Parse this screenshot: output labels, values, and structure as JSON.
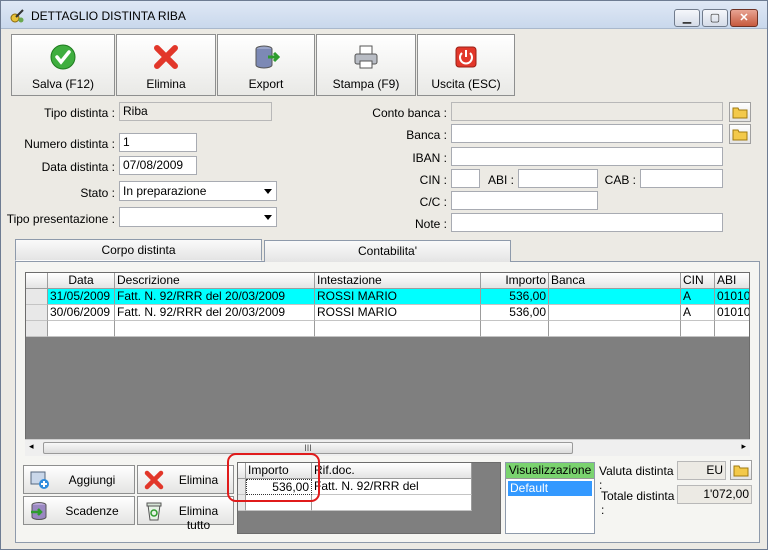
{
  "window": {
    "title": "DETTAGLIO DISTINTA RIBA",
    "btn_min": "▁",
    "btn_max": "▢",
    "btn_close": "✕"
  },
  "toolbar": [
    {
      "label": "Salva (F12)",
      "icon": "check-icon"
    },
    {
      "label": "Elimina",
      "icon": "delete-x-icon"
    },
    {
      "label": "Export",
      "icon": "export-database-icon"
    },
    {
      "label": "Stampa (F9)",
      "icon": "printer-icon"
    },
    {
      "label": "Uscita (ESC)",
      "icon": "power-exit-icon"
    }
  ],
  "form": {
    "tipo_distinta_label": "Tipo distinta :",
    "tipo_distinta_value": "Riba",
    "numero_label": "Numero distinta :",
    "numero_value": "1",
    "data_label": "Data distinta :",
    "data_value": "07/08/2009",
    "stato_label": "Stato :",
    "stato_value": "In preparazione",
    "tipo_pres_label": "Tipo presentazione :",
    "tipo_pres_value": "",
    "conto_banca_label": "Conto banca :",
    "conto_banca_value": "",
    "banca_label": "Banca :",
    "banca_value": "",
    "iban_label": "IBAN :",
    "iban_value": "",
    "cin_label": "CIN :",
    "cin_value": "",
    "abi_label": "ABI :",
    "abi_value": "",
    "cab_label": "CAB :",
    "cab_value": "",
    "cc_label": "C/C :",
    "cc_value": "",
    "note_label": "Note :",
    "note_value": ""
  },
  "tabs": [
    {
      "label": "Corpo distinta",
      "active": true
    },
    {
      "label": "Contabilita'",
      "active": false
    }
  ],
  "grid": {
    "columns": [
      "Data",
      "Descrizione",
      "Intestazione",
      "Importo",
      "Banca",
      "CIN",
      "ABI"
    ],
    "rows": [
      {
        "data": "31/05/2009",
        "descrizione": "Fatt. N. 92/RRR del 20/03/2009",
        "intestazione": "ROSSI MARIO",
        "importo": "536,00",
        "banca": "",
        "cin": "A",
        "abi": "01010",
        "selected": true
      },
      {
        "data": "30/06/2009",
        "descrizione": "Fatt. N. 92/RRR del 20/03/2009",
        "intestazione": "ROSSI MARIO",
        "importo": "536,00",
        "banca": "",
        "cin": "A",
        "abi": "01010",
        "selected": false
      }
    ],
    "scroll_thumb": "III"
  },
  "side_buttons": [
    {
      "label": "Aggiungi",
      "icon": "add-row-icon"
    },
    {
      "label": "Elimina",
      "icon": "delete-x-icon"
    },
    {
      "label": "Scadenze",
      "icon": "database-arrow-icon"
    },
    {
      "label": "Elimina tutto",
      "icon": "recycle-bin-icon"
    }
  ],
  "subgrid": {
    "columns": [
      "Importo",
      "Rif.doc."
    ],
    "rows": [
      {
        "importo": "536,00",
        "rif": "Fatt. N. 92/RRR del"
      }
    ]
  },
  "visualizzazione": {
    "header": "Visualizzazione",
    "items": [
      "Default"
    ]
  },
  "totals": {
    "valuta_label": "Valuta distinta :",
    "valuta_value": "EU",
    "totale_label": "Totale distinta :",
    "totale_value": "1'072,00"
  },
  "colors": {
    "highlight": "#00ffff",
    "vis_header": "#7ad36f",
    "annotation": "#e01b1b",
    "list_select": "#3399ff"
  }
}
